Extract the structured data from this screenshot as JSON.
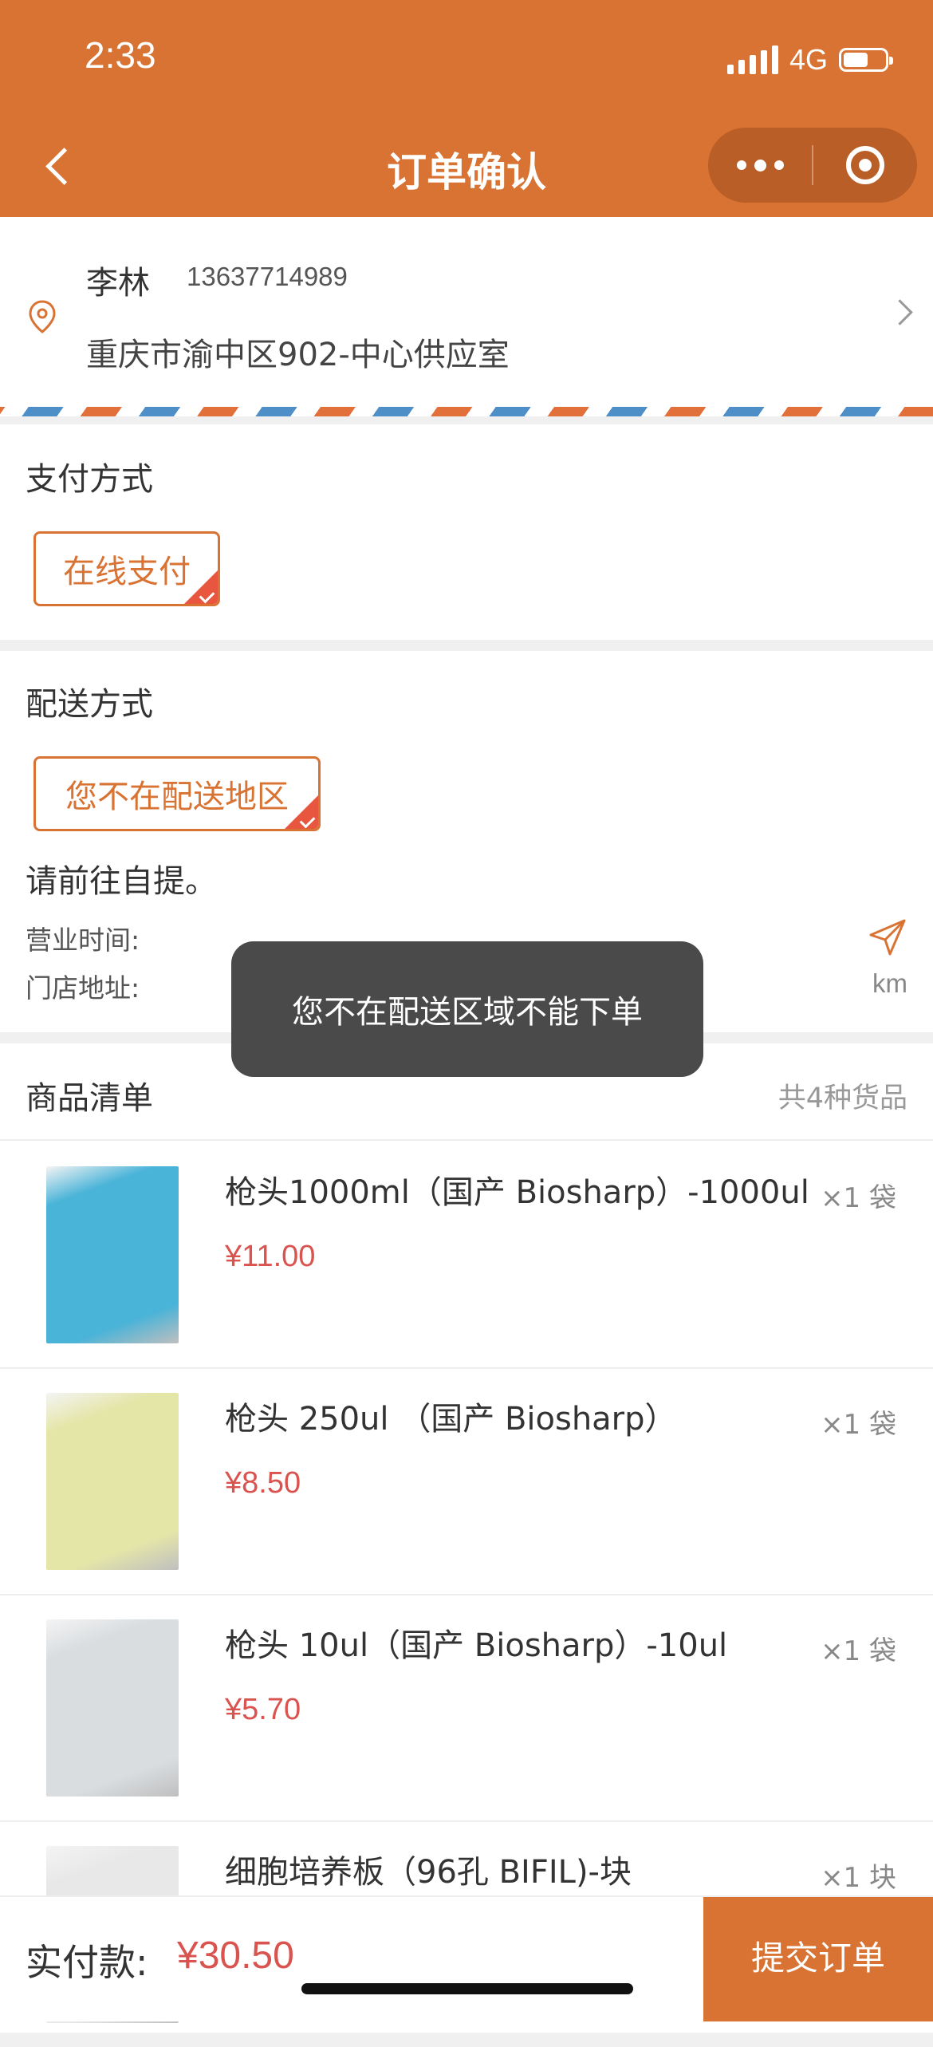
{
  "status_bar": {
    "time": "2:33",
    "network": "4G"
  },
  "nav": {
    "title": "订单确认"
  },
  "address": {
    "name": "李林",
    "phone": "13637714989",
    "detail": "重庆市渝中区902-中心供应室"
  },
  "payment": {
    "title": "支付方式",
    "selected_option": "在线支付"
  },
  "delivery": {
    "title": "配送方式",
    "selected_option": "您不在配送地区",
    "note": "请前往自提。",
    "hours_label": "营业时间:",
    "address_label": "门店地址:",
    "distance_unit": "km"
  },
  "goods": {
    "title": "商品清单",
    "count_text": "共4种货品",
    "items": [
      {
        "name": "枪头1000ml（国产 Biosharp）-1000ul",
        "price": "¥11.00",
        "qty": "×1 袋",
        "thumb_color": "#49b3d8"
      },
      {
        "name": "枪头 250ul （国产 Biosharp）",
        "price": "¥8.50",
        "qty": "×1 袋",
        "thumb_color": "#e4e6a8"
      },
      {
        "name": "枪头 10ul（国产 Biosharp）-10ul",
        "price": "¥5.70",
        "qty": "×1 袋",
        "thumb_color": "#d9dde0"
      },
      {
        "name": "细胞培养板（96孔 BIFIL)-块",
        "price": "",
        "qty": "×1 块",
        "thumb_color": "#e8e8e8"
      }
    ]
  },
  "footer": {
    "pay_label": "实付款:",
    "pay_amount": "¥30.50",
    "submit_label": "提交订单"
  },
  "toast": {
    "message": "您不在配送区域不能下单"
  },
  "colors": {
    "brand": "#d87333",
    "price": "#d9534f",
    "toast_bg": "#4a4a4a"
  }
}
